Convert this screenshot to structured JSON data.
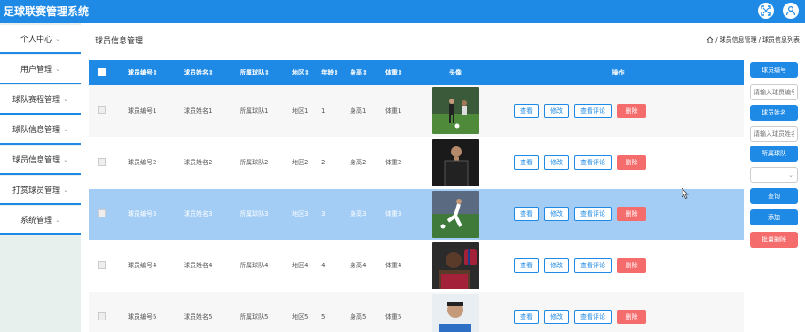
{
  "app": {
    "title": "足球联赛管理系统"
  },
  "topbar": {
    "fullscreen_icon": "fullscreen-icon",
    "user_icon": "user-icon"
  },
  "sidebar": {
    "items": [
      {
        "label": "个人中心"
      },
      {
        "label": "用户管理"
      },
      {
        "label": "球队赛程管理"
      },
      {
        "label": "球队信息管理"
      },
      {
        "label": "球员信息管理"
      },
      {
        "label": "打赏球员管理"
      },
      {
        "label": "系统管理"
      }
    ]
  },
  "page": {
    "title": "球员信息管理",
    "breadcrumb": [
      "球员信息管理",
      "球员信息列表"
    ],
    "breadcrumb_sep": "/"
  },
  "table": {
    "headers": {
      "player_no": "球员编号",
      "player_name": "球员姓名",
      "team": "所属球队",
      "region": "地区",
      "age": "年龄",
      "height": "身高",
      "weight": "体重",
      "avatar": "头像",
      "ops": "操作"
    },
    "sort_icon": "⇕",
    "rows": [
      {
        "player_no": "球员编号1",
        "player_name": "球员姓名1",
        "team": "所属球队1",
        "region": "地区1",
        "age": "1",
        "height": "身高1",
        "weight": "体重1",
        "selected": false
      },
      {
        "player_no": "球员编号2",
        "player_name": "球员姓名2",
        "team": "所属球队2",
        "region": "地区2",
        "age": "2",
        "height": "身高2",
        "weight": "体重2",
        "selected": false
      },
      {
        "player_no": "球员编号3",
        "player_name": "球员姓名3",
        "team": "所属球队3",
        "region": "地区3",
        "age": "3",
        "height": "身高3",
        "weight": "体重3",
        "selected": true
      },
      {
        "player_no": "球员编号4",
        "player_name": "球员姓名4",
        "team": "所属球队4",
        "region": "地区4",
        "age": "4",
        "height": "身高4",
        "weight": "体重4",
        "selected": false
      },
      {
        "player_no": "球员编号5",
        "player_name": "球员姓名5",
        "team": "所属球队5",
        "region": "地区5",
        "age": "5",
        "height": "身高5",
        "weight": "体重5",
        "selected": false
      }
    ],
    "actions": {
      "view": "查看",
      "edit": "修改",
      "comments": "查看评论",
      "delete": "删除"
    }
  },
  "search_panel": {
    "player_no_label": "球员编号",
    "player_no_placeholder": "请输入球员编号",
    "player_name_label": "球员姓名",
    "player_name_placeholder": "请输入球员姓名",
    "team_label": "所属球队",
    "search_button": "查询",
    "add_button": "添加",
    "batch_delete_button": "批量删除"
  },
  "colors": {
    "primary": "#1f8ae6",
    "danger": "#f56c6c",
    "selected_row": "#a3cdf5"
  }
}
